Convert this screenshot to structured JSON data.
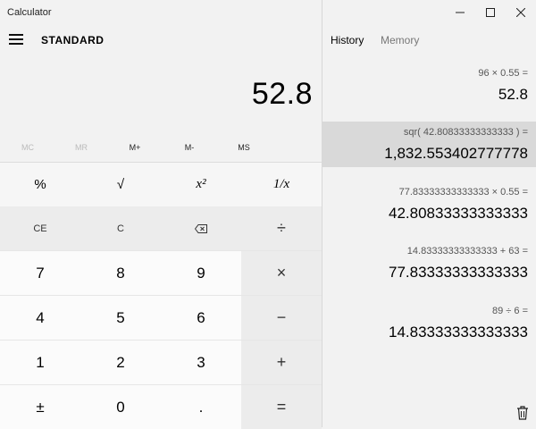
{
  "window": {
    "title": "Calculator"
  },
  "header": {
    "mode": "STANDARD"
  },
  "display": {
    "value": "52.8"
  },
  "memory": [
    "MC",
    "MR",
    "M+",
    "M-",
    "MS"
  ],
  "functions": [
    "%",
    "√",
    "x²",
    "1/x"
  ],
  "keys": {
    "ce": "CE",
    "c": "C",
    "divide": "÷",
    "multiply": "×",
    "minus": "−",
    "plus": "+",
    "equals": "=",
    "n7": "7",
    "n8": "8",
    "n9": "9",
    "n4": "4",
    "n5": "5",
    "n6": "6",
    "n1": "1",
    "n2": "2",
    "n3": "3",
    "negate": "±",
    "n0": "0",
    "decimal": "."
  },
  "tabs": {
    "history": "History",
    "memory": "Memory"
  },
  "history": [
    {
      "expr": "96   ×   0.55 =",
      "result": "52.8"
    },
    {
      "expr": "sqr( 42.80833333333333 ) =",
      "result": "1,832.553402777778"
    },
    {
      "expr": "77.83333333333333   ×   0.55 =",
      "result": "42.80833333333333"
    },
    {
      "expr": "14.83333333333333   +   63 =",
      "result": "77.83333333333333"
    },
    {
      "expr": "89   ÷   6 =",
      "result": "14.83333333333333"
    }
  ],
  "colors": {
    "selected_history": "#d9d9d9",
    "number_key": "#fbfbfb",
    "operator_key": "#ececec"
  }
}
